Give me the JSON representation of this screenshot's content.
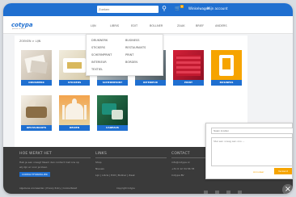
{
  "topbar": {
    "search_placeholder": "Zoeken",
    "cart_count": "0",
    "links": [
      "Winkelwagen",
      "Mijn account"
    ]
  },
  "header": {
    "logo_main": "cotypa",
    "logo_accent": "o",
    "logo_sub": "printen en meer",
    "nav": [
      "LIJN",
      "LIBRIS",
      "EDIT",
      "BOLLNER",
      "ZAAK",
      "BRIEF",
      "ANDERS"
    ]
  },
  "dropdown": {
    "col1": [
      "DRUKWERK",
      "STICKERS",
      "SCHERMPRINT",
      "INTERIEUR",
      "TEXTIEL"
    ],
    "col2": [
      "BUSINESS",
      "RESTAURANTS",
      "PRINT",
      "BORDEN"
    ]
  },
  "breadcrumb": "ZOEKEN  >  LIJN",
  "tiles": [
    {
      "label": "DRUKWERK"
    },
    {
      "label": "STICKERS"
    },
    {
      "label": "SCHERMPRINT"
    },
    {
      "label": "INTERIEUR"
    },
    {
      "label": "PRINT"
    },
    {
      "label": "BUSINESS"
    },
    {
      "label": "RESTAURANTS"
    },
    {
      "label": "REIZEN"
    },
    {
      "label": "CADEAUS"
    }
  ],
  "footer": {
    "col1_title": "HOE WERKT HET",
    "col1_text1": "Heb je een vraag? Neem dan contact met ons op",
    "col1_text2": "wij zijn er voor je klaar.",
    "col1_button": "CONTACTFORMULIER",
    "col1_bottom": "Algemene voorwaarden  |  Privacy Policy  |  Cookie Beleid",
    "col2_title": "LINKS",
    "col2_items": [
      "Shop",
      "Nieuws",
      "Lijn | Libris | Edit | Bollner | Zaak"
    ],
    "col2_bottom": "Copyright Cotypa",
    "col3_title": "CONTACT",
    "col3_items": [
      "info@cotypa.nl",
      "+31 6 12 34 56 78",
      "Cotypa BV"
    ],
    "colors": {
      "footer_bg": "#3a3a3a",
      "accent": "#f6a400",
      "brand": "#1f6fd0"
    }
  },
  "chat": {
    "name_placeholder": "Naam invullen",
    "message_placeholder": "Stel een vraag aan ons ...",
    "cancel": "Annuleer",
    "send": "Verzend"
  }
}
